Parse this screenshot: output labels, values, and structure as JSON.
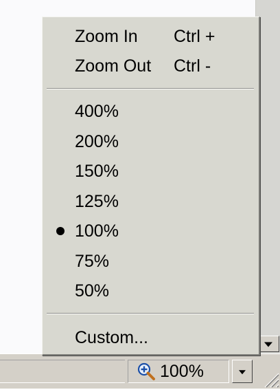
{
  "zoom_menu": {
    "zoom_in": {
      "label": "Zoom In",
      "shortcut": "Ctrl +"
    },
    "zoom_out": {
      "label": "Zoom Out",
      "shortcut": "Ctrl -"
    },
    "presets": [
      {
        "label": "400%",
        "selected": false
      },
      {
        "label": "200%",
        "selected": false
      },
      {
        "label": "150%",
        "selected": false
      },
      {
        "label": "125%",
        "selected": false
      },
      {
        "label": "100%",
        "selected": true
      },
      {
        "label": "75%",
        "selected": false
      },
      {
        "label": "50%",
        "selected": false
      }
    ],
    "custom": {
      "label": "Custom..."
    }
  },
  "status_bar": {
    "zoom_value": "100%",
    "zoom_icon": "magnifier-plus-icon"
  }
}
